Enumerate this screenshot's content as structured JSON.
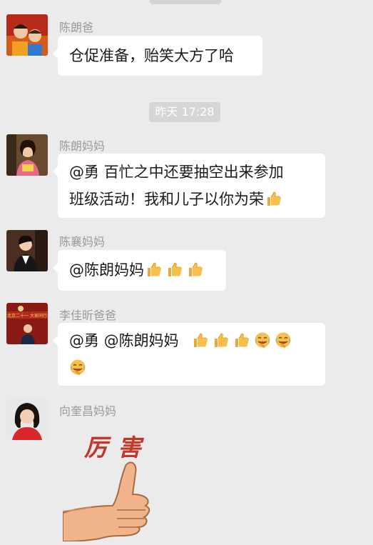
{
  "timestamp": "昨天 17:28",
  "messages": [
    {
      "sender": "陈朗爸",
      "text": "仓促准备，贻笑大方了哈"
    },
    {
      "sender": "陈朗妈妈",
      "line1": "@勇  百忙之中还要抽空出来参加",
      "line2": "班级活动！我和儿子以你为荣"
    },
    {
      "sender": "陈襄妈妈",
      "text": "@陈朗妈妈"
    },
    {
      "sender": "李佳昕爸爸",
      "text": "@勇   @陈朗妈妈"
    },
    {
      "sender": "向奎昌妈妈",
      "sticker_text": "厉害"
    }
  ],
  "banner_text": "北京二十一 大家同行",
  "colors": {
    "background": "#ebebeb",
    "bubble": "#ffffff",
    "sender": "#9a9a9a",
    "timestamp_pill": "#d6d6d6",
    "sticker_text": "#c0392b"
  },
  "icons": [
    "thumbs-up-emoji",
    "tears-of-joy-emoji",
    "thumbs-up-sticker"
  ]
}
